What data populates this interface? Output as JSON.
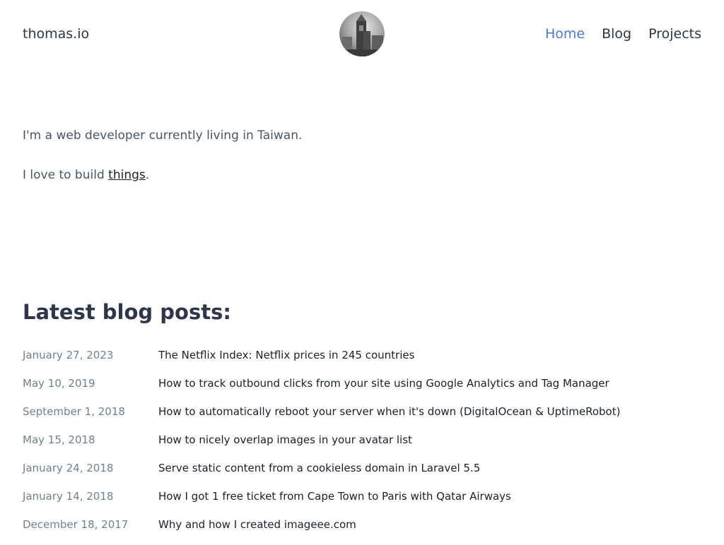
{
  "header": {
    "brand": "thomas.io",
    "nav": [
      {
        "label": "Home",
        "active": true
      },
      {
        "label": "Blog",
        "active": false
      },
      {
        "label": "Projects",
        "active": false
      }
    ]
  },
  "intro": {
    "line1": "I'm a web developer currently living in Taiwan.",
    "line2_prefix": "I love to build ",
    "line2_link": "things",
    "line2_suffix": "."
  },
  "posts": {
    "heading": "Latest blog posts:",
    "items": [
      {
        "date": "January 27, 2023",
        "title": "The Netflix Index: Netflix prices in 245 countries"
      },
      {
        "date": "May 10, 2019",
        "title": "How to track outbound clicks from your site using Google Analytics and Tag Manager"
      },
      {
        "date": "September 1, 2018",
        "title": "How to automatically reboot your server when it's down (DigitalOcean & UptimeRobot)"
      },
      {
        "date": "May 15, 2018",
        "title": "How to nicely overlap images in your avatar list"
      },
      {
        "date": "January 24, 2018",
        "title": "Serve static content from a cookieless domain in Laravel 5.5"
      },
      {
        "date": "January 14, 2018",
        "title": "How I got 1 free ticket from Cape Town to Paris with Qatar Airways"
      },
      {
        "date": "December 18, 2017",
        "title": "Why and how I created imageee.com"
      }
    ]
  },
  "colors": {
    "nav_active": "#4a7bd9",
    "text": "#2d3748",
    "muted": "#718096",
    "link": "#1a202c"
  }
}
